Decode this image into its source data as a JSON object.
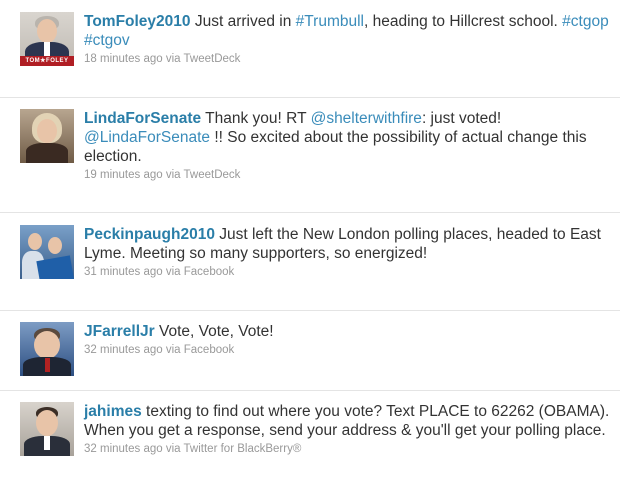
{
  "tweets": [
    {
      "username": "TomFoley2010",
      "text_parts": [
        " Just arrived in ",
        "#Trumbull",
        ", heading to Hillcrest school. ",
        "#ctgop",
        " ",
        "#ctgov"
      ],
      "time": "18 minutes ago",
      "via": "via",
      "source": "TweetDeck",
      "avatar_label": "TOM★FOLEY"
    },
    {
      "username": "LindaForSenate",
      "text_parts": [
        " Thank you! RT ",
        "@shelterwithfire",
        ": just voted! ",
        "@LindaForSenate",
        " !! So excited about the possibility of actual change this election."
      ],
      "time": "19 minutes ago",
      "via": "via",
      "source": "TweetDeck"
    },
    {
      "username": "Peckinpaugh2010",
      "text_parts": [
        " Just left the New London polling places, headed to East Lyme. Meeting so many supporters, so energized!"
      ],
      "time": "31 minutes ago",
      "via": "via",
      "source": "Facebook"
    },
    {
      "username": "JFarrellJr",
      "text_parts": [
        " Vote, Vote, Vote!"
      ],
      "time": "32 minutes ago",
      "via": "via",
      "source": "Facebook"
    },
    {
      "username": "jahimes",
      "text_parts": [
        " texting to find out where you vote? Text PLACE to 62262 (OBAMA). When you get a response, send your address & you'll get your polling place."
      ],
      "time": "32 minutes ago",
      "via": "via",
      "source": "Twitter for BlackBerry®"
    }
  ],
  "colors": {
    "username": "#2a7ea8",
    "link": "#3a8cba",
    "meta": "#999999",
    "divider": "#e4e4e4"
  }
}
